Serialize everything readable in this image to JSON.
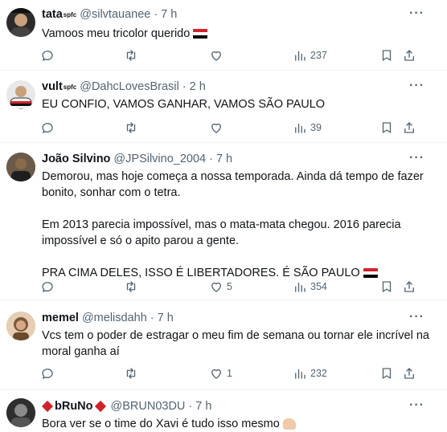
{
  "tweets": [
    {
      "name": "tata",
      "name_sup": "spfc",
      "handle": "@silvtauanee",
      "dot": "·",
      "time": "7 h",
      "lines": [
        "Vamoos meu tricolor querido"
      ],
      "views": "237",
      "likes": "",
      "avatar_colors": [
        "#2b2b2b",
        "#c8a27c"
      ]
    },
    {
      "name": "vult",
      "name_sup": "spfc",
      "handle": "@DahcLovesBrasil",
      "dot": "·",
      "time": "2 h",
      "lines": [
        "EU CONFIO, VAMOS GANHAR, VAMOS SÃO PAULO"
      ],
      "views": "39",
      "likes": "",
      "avatar_colors": [
        "#e8e8e8",
        "#3a3a3a"
      ]
    },
    {
      "name": "João Silvino",
      "name_sup": "",
      "handle": "@JPSilvino_2004",
      "dot": "·",
      "time": "7 h",
      "lines": [
        "Demorou, mas hoje começa a nossa temporada. Ainda dá tempo de fazer",
        "bonito, sonhar com o tetra.",
        "",
        "Em 2013 parecia impossível, mas o mata-mata chegou. 2016 parecia",
        "impossível e só o apito parou a gente.",
        "",
        "PRA CIMA DELES, ISSO É LIBERTADORES. É SÃO PAULO"
      ],
      "views": "354",
      "likes": "5",
      "avatar_colors": [
        "#5a4a3a",
        "#2a2a2a"
      ]
    },
    {
      "name": "memel",
      "name_sup": "",
      "handle": "@melisdahh",
      "dot": "·",
      "time": "7 h",
      "lines": [
        "Vcs tem o poder de estragar o meu fim de semana ou tornar ele incrível na",
        "moral ganha aí"
      ],
      "views": "232",
      "likes": "1",
      "avatar_colors": [
        "#d9b99b",
        "#7a5a3a"
      ]
    },
    {
      "name": "bRuNo",
      "name_sup": "",
      "handle": "@BRUN03DU",
      "dot": "·",
      "time": "7 h",
      "lines": [
        "Bora ver se o time do Xavi é tudo isso mesmo"
      ],
      "views": "",
      "likes": "",
      "avatar_colors": [
        "#3a3a3a",
        "#9a9a9a"
      ]
    }
  ],
  "more_label": "···",
  "flag_colors": [
    "#d0222a",
    "#ffffff",
    "#000000"
  ],
  "icons": {
    "reply": "reply-icon",
    "retweet": "retweet-icon",
    "like": "heart-icon",
    "views": "views-icon",
    "bookmark": "bookmark-icon",
    "share": "share-icon"
  }
}
